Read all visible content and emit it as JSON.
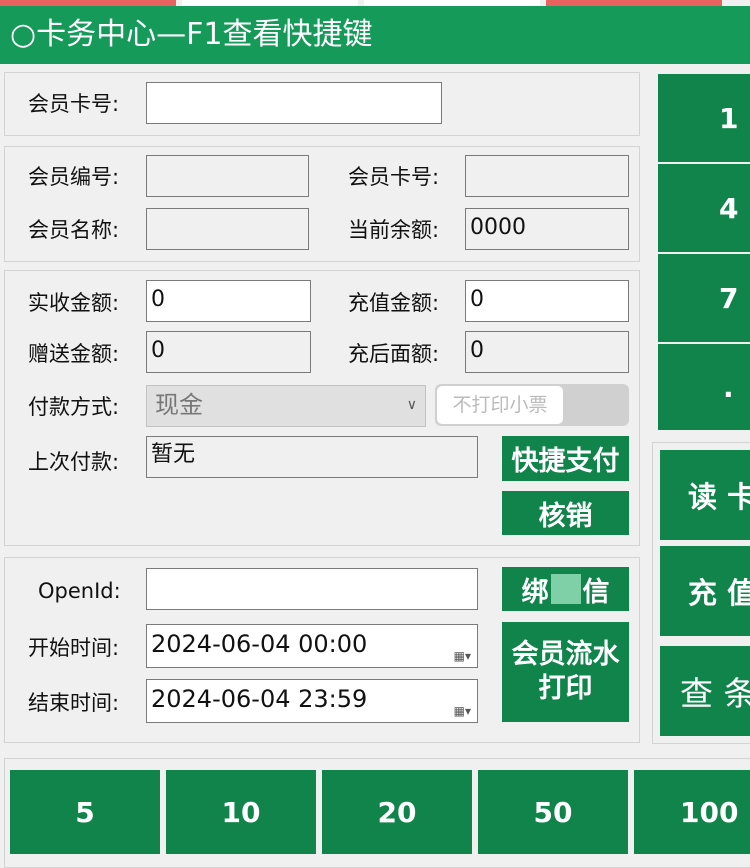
{
  "window": {
    "title": "○卡务中心—F1查看快捷键"
  },
  "card_search": {
    "card_no_label": "会员卡号:",
    "card_no_value": ""
  },
  "member_info": {
    "member_id_label": "会员编号:",
    "member_id_value": "",
    "card_no_label": "会员卡号:",
    "card_no_value": "",
    "member_name_label": "会员名称:",
    "member_name_value": "",
    "balance_label": "当前余额:",
    "balance_value": "0000"
  },
  "payment": {
    "received_label": "实收金额:",
    "received_value": "0",
    "recharge_label": "充值金额:",
    "recharge_value": "0",
    "gift_label": "赠送金额:",
    "gift_value": "0",
    "after_label": "充后面额:",
    "after_value": "0",
    "method_label": "付款方式:",
    "method_value": "现金",
    "print_toggle_label": "不打印小票",
    "last_payment_label": "上次付款:",
    "last_payment_value": "暂无",
    "quick_pay_button": "快捷支付",
    "verify_button": "核销"
  },
  "wechat": {
    "openid_label": "OpenId:",
    "openid_value": "",
    "bind_button": "绑",
    "bind_button_tail": "信",
    "start_time_label": "开始时间:",
    "start_time_value": "2024-06-04 00:00",
    "end_time_label": "结束时间:",
    "end_time_value": "2024-06-04 23:59",
    "flow_print_line1": "会员流水",
    "flow_print_line2": "打印"
  },
  "keypad": {
    "keys": [
      "1",
      "4",
      "7",
      "."
    ]
  },
  "actions": {
    "read_card": "读 卡",
    "recharge": "充 值",
    "query": "查 条"
  },
  "quick_amounts": [
    "5",
    "10",
    "20",
    "50",
    "100"
  ],
  "colors": {
    "title_bar": "#159a5a",
    "button_green": "#11844b",
    "top_strip_red": "#e8635f"
  }
}
